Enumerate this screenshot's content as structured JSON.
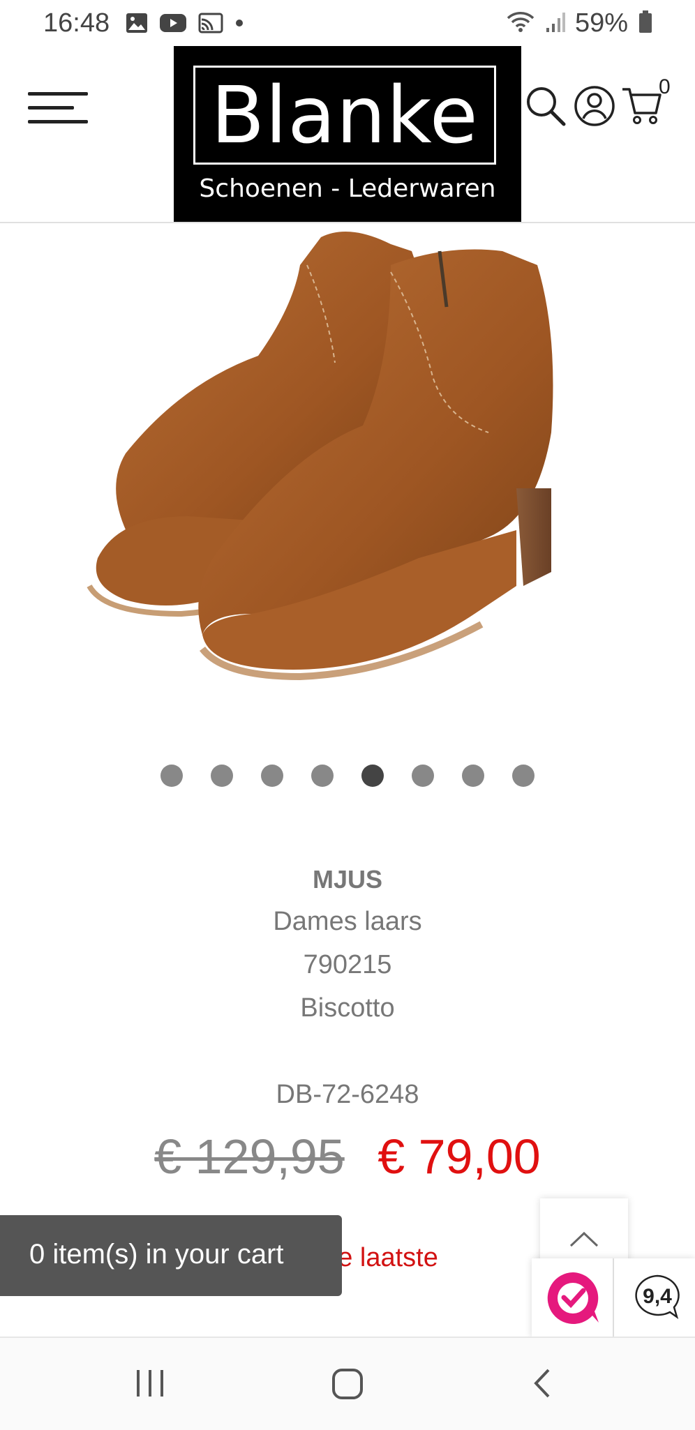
{
  "status_bar": {
    "time": "16:48",
    "battery": "59%",
    "icons_left": [
      "gallery-icon",
      "youtube-icon",
      "cast-icon",
      "dot-icon"
    ],
    "icons_right": [
      "wifi-icon",
      "signal-icon",
      "battery-icon"
    ]
  },
  "header": {
    "logo_name": "Blanke",
    "logo_subtitle": "Schoenen - Lederwaren",
    "cart_count": "0"
  },
  "carousel": {
    "total": 8,
    "active_index": 4
  },
  "product": {
    "brand": "MJUS",
    "type": "Dames laars",
    "article": "790215",
    "color": "Biscotto",
    "sku": "DB-72-6248",
    "old_price": "€ 129,95",
    "new_price": "€ 79,00",
    "stock_note": "Dit is de laatste"
  },
  "toast": {
    "text": "0 item(s) in your cart"
  },
  "review": {
    "score": "9,4"
  },
  "colors": {
    "sale_red": "#e01010",
    "logo_bg": "#000000",
    "toast_bg": "#555555",
    "review_brand": "#e5197d"
  }
}
